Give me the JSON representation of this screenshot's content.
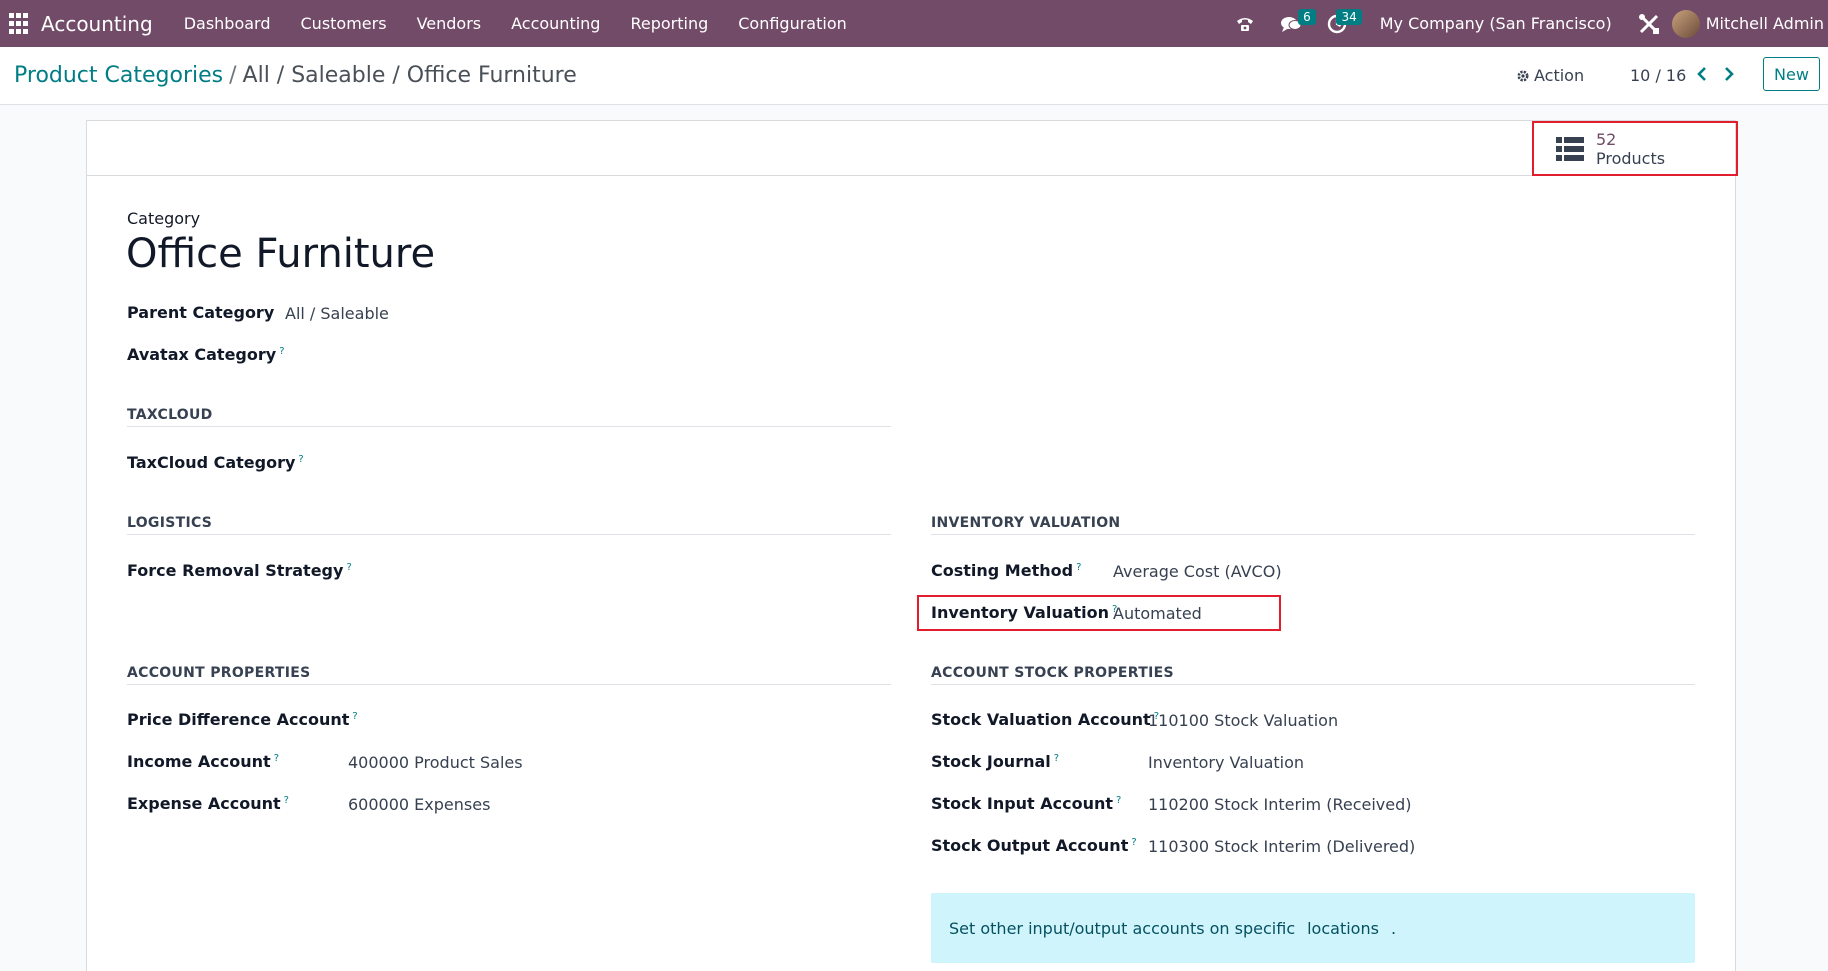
{
  "navbar": {
    "app_name": "Accounting",
    "menu": [
      "Dashboard",
      "Customers",
      "Vendors",
      "Accounting",
      "Reporting",
      "Configuration"
    ],
    "messages_count": "6",
    "activities_count": "34",
    "company": "My Company (San Francisco)",
    "user": "Mitchell Admin"
  },
  "breadcrumb": {
    "parent": "Product Categories",
    "separator": "/",
    "current": "All / Saleable / Office Furniture"
  },
  "control": {
    "action_label": "Action",
    "pager": "10 / 16",
    "new_label": "New"
  },
  "smart_button": {
    "value": "52",
    "label": "Products"
  },
  "form": {
    "category_caption": "Category",
    "title": "Office Furniture",
    "parent_category_label": "Parent Category",
    "parent_category_value": "All / Saleable",
    "avatax_label": "Avatax Category",
    "taxcloud_section": "TAXCLOUD",
    "taxcloud_label": "TaxCloud Category",
    "logistics_section": "LOGISTICS",
    "removal_label": "Force Removal Strategy",
    "inventory_section": "INVENTORY VALUATION",
    "costing_label": "Costing Method",
    "costing_value": "Average Cost (AVCO)",
    "valuation_label": "Inventory Valuation",
    "valuation_value": "Automated",
    "account_section": "ACCOUNT PROPERTIES",
    "price_diff_label": "Price Difference Account",
    "income_label": "Income Account",
    "income_value": "400000 Product Sales",
    "expense_label": "Expense Account",
    "expense_value": "600000 Expenses",
    "stock_section": "ACCOUNT STOCK PROPERTIES",
    "stock_valuation_label": "Stock Valuation Account",
    "stock_valuation_value": "110100 Stock Valuation",
    "stock_journal_label": "Stock Journal",
    "stock_journal_value": "Inventory Valuation",
    "stock_input_label": "Stock Input Account",
    "stock_input_value": "110200 Stock Interim (Received)",
    "stock_output_label": "Stock Output Account",
    "stock_output_value": "110300 Stock Interim (Delivered)",
    "tooltip_marker": "?",
    "info_text": "Set other input/output accounts on specific",
    "info_link": "locations",
    "info_suffix": "."
  },
  "colors": {
    "navbar": "#714b67",
    "accent": "#017e84",
    "highlight": "#e11d2e",
    "info_bg": "#cff4fc"
  },
  "icons": [
    "apps-grid-icon",
    "phone-icon",
    "chat-icon",
    "clock-icon",
    "tools-icon",
    "gear-icon",
    "chevron-left-icon",
    "chevron-right-icon",
    "list-icon"
  ]
}
